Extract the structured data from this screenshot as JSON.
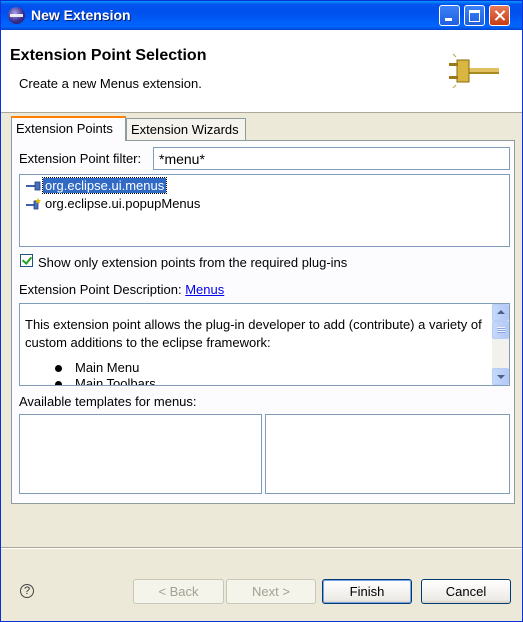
{
  "window": {
    "title": "New Extension"
  },
  "header": {
    "title": "Extension Point Selection",
    "description": "Create a new Menus extension."
  },
  "tabs": [
    {
      "label": "Extension Points",
      "active": true
    },
    {
      "label": "Extension Wizards",
      "active": false
    }
  ],
  "filter": {
    "label": "Extension Point filter:",
    "value": "*menu*"
  },
  "extension_points": [
    {
      "label": "org.eclipse.ui.menus",
      "selected": true
    },
    {
      "label": "org.eclipse.ui.popupMenus",
      "selected": false
    }
  ],
  "show_required": {
    "label": "Show only extension points from the required plug-ins",
    "checked": true
  },
  "description": {
    "label": "Extension Point Description:",
    "link": "Menus",
    "text": "This extension point allows the plug-in developer to add (contribute) a variety of custom additions to the eclipse framework:",
    "bullets": [
      "Main Menu",
      "Main Toolbars"
    ]
  },
  "templates": {
    "label": "Available templates for menus:"
  },
  "buttons": {
    "help": "?",
    "back": "< Back",
    "next": "Next >",
    "finish": "Finish",
    "cancel": "Cancel"
  },
  "colors": {
    "titlebar": "#0054e3",
    "selection": "#316ac5",
    "active_tab_accent": "#ff8000",
    "dialog_bg": "#ece9d8"
  }
}
